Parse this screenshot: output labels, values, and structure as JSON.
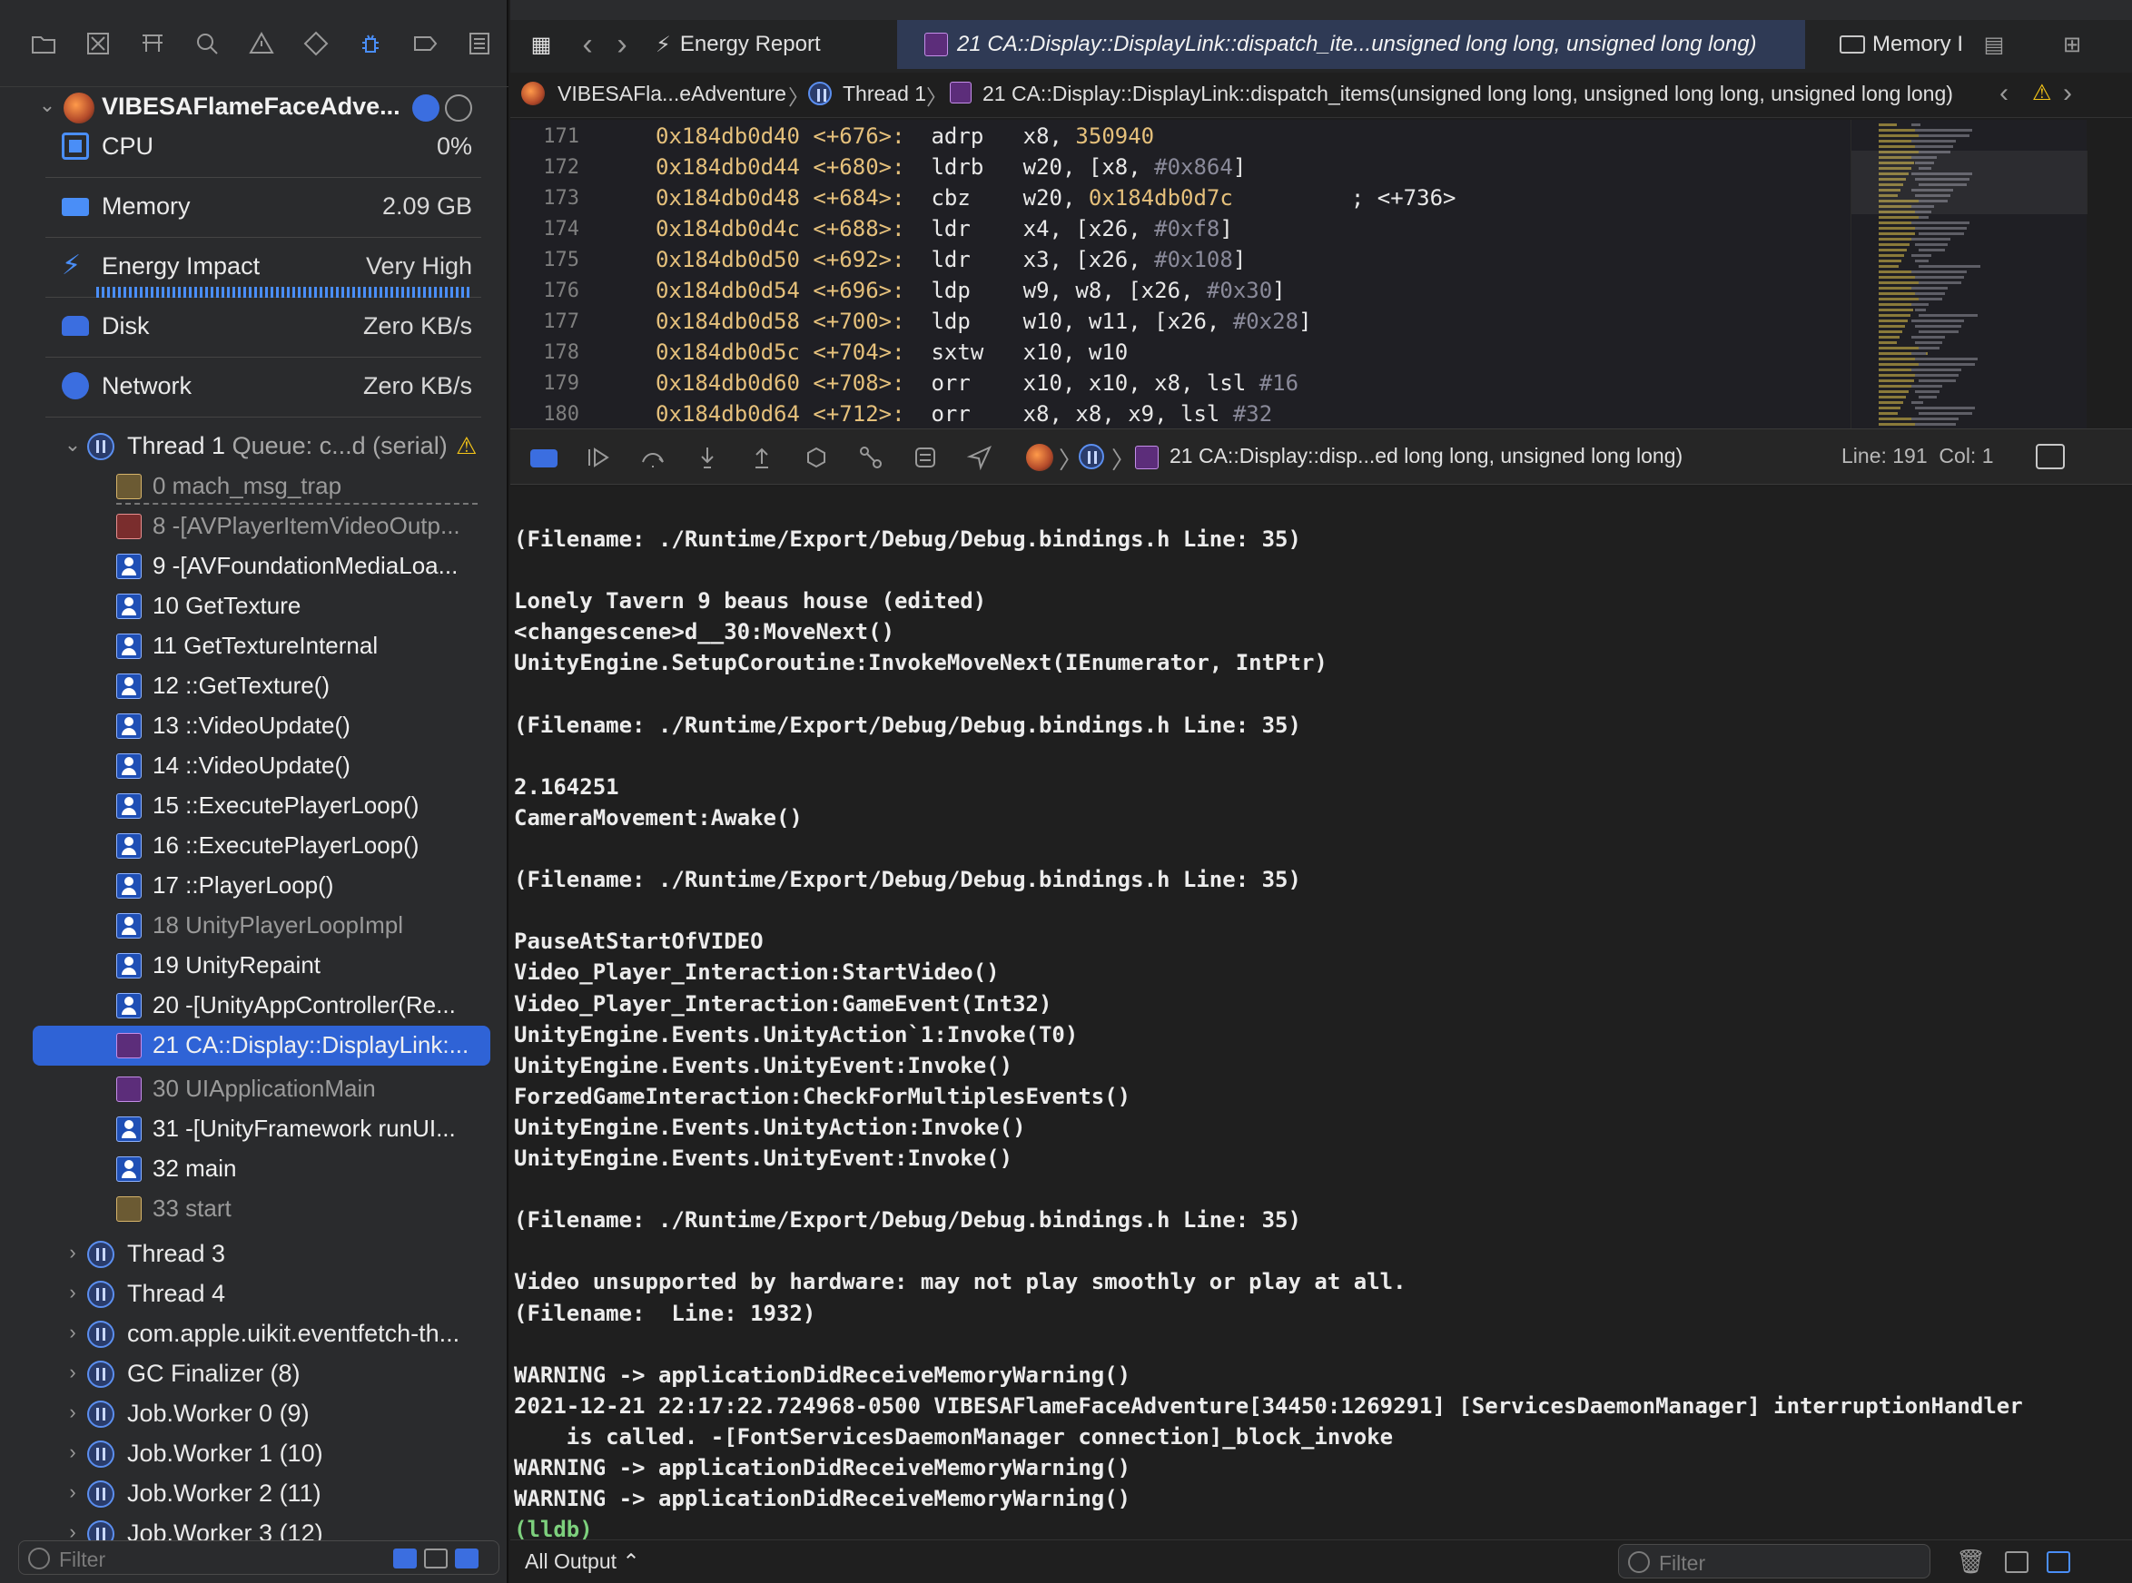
{
  "process": {
    "name": "VIBESAFlameFaceAdve..."
  },
  "gauges": [
    {
      "label": "CPU",
      "value": "0%"
    },
    {
      "label": "Memory",
      "value": "2.09 GB"
    },
    {
      "label": "Energy Impact",
      "value": "Very High"
    },
    {
      "label": "Disk",
      "value": "Zero KB/s"
    },
    {
      "label": "Network",
      "value": "Zero KB/s"
    }
  ],
  "thread1": {
    "label": "Thread 1",
    "queue": "Queue: c...d (serial)"
  },
  "frames": [
    {
      "label": "0 mach_msg_trap",
      "dim": true
    },
    {
      "label": "8 -[AVPlayerItemVideoOutp...",
      "dim": true
    },
    {
      "label": "9 -[AVFoundationMediaLoa..."
    },
    {
      "label": "10 GetTexture"
    },
    {
      "label": "11 GetTextureInternal"
    },
    {
      "label": "12 ::GetTexture()"
    },
    {
      "label": "13 ::VideoUpdate()"
    },
    {
      "label": "14 ::VideoUpdate()"
    },
    {
      "label": "15 ::ExecutePlayerLoop()"
    },
    {
      "label": "16 ::ExecutePlayerLoop()"
    },
    {
      "label": "17 ::PlayerLoop()"
    },
    {
      "label": "18 UnityPlayerLoopImpl",
      "dim": true
    },
    {
      "label": "19 UnityRepaint"
    },
    {
      "label": "20 -[UnityAppController(Re..."
    },
    {
      "label": "21 CA::Display::DisplayLink:..."
    },
    {
      "label": "30 UIApplicationMain",
      "dim": true
    },
    {
      "label": "31 -[UnityFramework runUI..."
    },
    {
      "label": "32 main"
    },
    {
      "label": "33 start",
      "dim": true
    }
  ],
  "threads": [
    {
      "label": "Thread 3"
    },
    {
      "label": "Thread 4"
    },
    {
      "label": "com.apple.uikit.eventfetch-th..."
    },
    {
      "label": "GC Finalizer (8)"
    },
    {
      "label": "Job.Worker 0 (9)"
    },
    {
      "label": "Job.Worker 1 (10)"
    },
    {
      "label": "Job.Worker 2 (11)"
    },
    {
      "label": "Job.Worker 3 (12)"
    }
  ],
  "sidebar_filter": {
    "placeholder": "Filter"
  },
  "tabs": {
    "energy": "Energy Report",
    "active": "21 CA::Display::DisplayLink::dispatch_ite...unsigned long long, unsigned long long)",
    "memory": "Memory I"
  },
  "jump_bar": {
    "project": "VIBESAFla...eAdventure",
    "thread": "Thread 1",
    "frame": "21 CA::Display::DisplayLink::dispatch_items(unsigned long long, unsigned long long, unsigned long long)"
  },
  "code_lines": [
    {
      "ln": "171",
      "addr": "0x184db0d40",
      "off": "<+676>:",
      "op": "adrp",
      "args": "x8, ",
      "hex": "350940",
      "rest": ""
    },
    {
      "ln": "172",
      "addr": "0x184db0d44",
      "off": "<+680>:",
      "op": "ldrb",
      "args": "w20, [x8, ",
      "num": "#0x864",
      "rest": "]"
    },
    {
      "ln": "173",
      "addr": "0x184db0d48",
      "off": "<+684>:",
      "op": "cbz ",
      "args": "w20, ",
      "hex": "0x184db0d7c",
      "rest": "         ; <+736>"
    },
    {
      "ln": "174",
      "addr": "0x184db0d4c",
      "off": "<+688>:",
      "op": "ldr ",
      "args": "x4, [x26, ",
      "num": "#0xf8",
      "rest": "]"
    },
    {
      "ln": "175",
      "addr": "0x184db0d50",
      "off": "<+692>:",
      "op": "ldr ",
      "args": "x3, [x26, ",
      "num": "#0x108",
      "rest": "]"
    },
    {
      "ln": "176",
      "addr": "0x184db0d54",
      "off": "<+696>:",
      "op": "ldp ",
      "args": "w9, w8, [x26, ",
      "num": "#0x30",
      "rest": "]"
    },
    {
      "ln": "177",
      "addr": "0x184db0d58",
      "off": "<+700>:",
      "op": "ldp ",
      "args": "w10, w11, [x26, ",
      "num": "#0x28",
      "rest": "]"
    },
    {
      "ln": "178",
      "addr": "0x184db0d5c",
      "off": "<+704>:",
      "op": "sxtw",
      "args": "x10, w10",
      "rest": ""
    },
    {
      "ln": "179",
      "addr": "0x184db0d60",
      "off": "<+708>:",
      "op": "orr ",
      "args": "x10, x10, x8, lsl ",
      "num": "#16",
      "rest": ""
    },
    {
      "ln": "180",
      "addr": "0x184db0d64",
      "off": "<+712>:",
      "op": "orr ",
      "args": "x8, x8, x9, lsl ",
      "num": "#32",
      "rest": ""
    }
  ],
  "debug_bar": {
    "frame": "21 CA::Display::disp...ed long long, unsigned long long)",
    "position": "Line: 191  Col: 1"
  },
  "console_lines": [
    "(Filename: ./Runtime/Export/Debug/Debug.bindings.h Line: 35)",
    "",
    "Lonely Tavern 9 beaus house (edited)",
    "<changescene>d__30:MoveNext()",
    "UnityEngine.SetupCoroutine:InvokeMoveNext(IEnumerator, IntPtr)",
    "",
    "(Filename: ./Runtime/Export/Debug/Debug.bindings.h Line: 35)",
    "",
    "2.164251",
    "CameraMovement:Awake()",
    "",
    "(Filename: ./Runtime/Export/Debug/Debug.bindings.h Line: 35)",
    "",
    "PauseAtStartOfVIDEO",
    "Video_Player_Interaction:StartVideo()",
    "Video_Player_Interaction:GameEvent(Int32)",
    "UnityEngine.Events.UnityAction`1:Invoke(T0)",
    "UnityEngine.Events.UnityEvent:Invoke()",
    "ForzedGameInteraction:CheckForMultiplesEvents()",
    "UnityEngine.Events.UnityAction:Invoke()",
    "UnityEngine.Events.UnityEvent:Invoke()",
    "",
    "(Filename: ./Runtime/Export/Debug/Debug.bindings.h Line: 35)",
    "",
    "Video unsupported by hardware: may not play smoothly or play at all.",
    "(Filename:  Line: 1932)",
    "",
    "WARNING -> applicationDidReceiveMemoryWarning()",
    "2021-12-21 22:17:22.724968-0500 VIBESAFlameFaceAdventure[34450:1269291] [ServicesDaemonManager] interruptionHandler",
    "    is called. -[FontServicesDaemonManager connection]_block_invoke",
    "WARNING -> applicationDidReceiveMemoryWarning()",
    "WARNING -> applicationDidReceiveMemoryWarning()",
    "(lldb)"
  ],
  "console_footer": {
    "output_selector": "All Output ⌃",
    "filter_placeholder": "Filter"
  },
  "colors": {
    "selection": "#2f63d6",
    "accent": "#4a8ef7",
    "warning": "#f5c518",
    "prompt": "#7dd07d"
  }
}
